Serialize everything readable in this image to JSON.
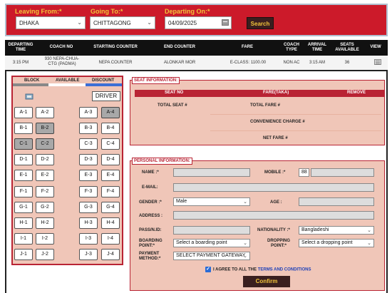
{
  "search": {
    "leaving_label": "Leaving From:*",
    "going_label": "Going To:*",
    "departing_label": "Departing On:*",
    "leaving_value": "DHAKA",
    "going_value": "CHITTAGONG",
    "date_value": "04/09/2025",
    "button": "Search"
  },
  "results": {
    "headers": [
      "DEPARTING TIME",
      "COACH NO",
      "STARTING COUNTER",
      "END COUNTER",
      "FARE",
      "COACH TYPE",
      "ARRIVAL TIME",
      "SEATS AVAILABLE",
      "VIEW"
    ],
    "rows": [
      {
        "departing": "3:15 PM",
        "coach_no": "930 NEPA-CHUA-CTG (PADMA)",
        "start": "NEPA COUNTER",
        "end": "ALONKAR MOR",
        "fare": "E-CLASS: 1100.00",
        "type": "NON AC",
        "arrival": "3:15 AM",
        "seats": "36"
      }
    ]
  },
  "seatmap": {
    "legend": {
      "block": "BLOCK",
      "available": "AVAILABLE",
      "discount": "DISCOUNT"
    },
    "legend_colors": {
      "block": "#888888",
      "available": "#ffffff",
      "discount": "#3c6fd6"
    },
    "driver": "DRIVER",
    "seats": [
      {
        "label": "A-1",
        "booked": false
      },
      {
        "label": "A-2",
        "booked": false
      },
      {
        "label": "A-3",
        "booked": false
      },
      {
        "label": "A-4",
        "booked": true
      },
      {
        "label": "B-1",
        "booked": false
      },
      {
        "label": "B-2",
        "booked": true
      },
      {
        "label": "B-3",
        "booked": false
      },
      {
        "label": "B-4",
        "booked": false
      },
      {
        "label": "C-1",
        "booked": true
      },
      {
        "label": "C-2",
        "booked": true
      },
      {
        "label": "C-3",
        "booked": false
      },
      {
        "label": "C-4",
        "booked": false
      },
      {
        "label": "D-1",
        "booked": false
      },
      {
        "label": "D-2",
        "booked": false
      },
      {
        "label": "D-3",
        "booked": false
      },
      {
        "label": "D-4",
        "booked": false
      },
      {
        "label": "E-1",
        "booked": false
      },
      {
        "label": "E-2",
        "booked": false
      },
      {
        "label": "E-3",
        "booked": false
      },
      {
        "label": "E-4",
        "booked": false
      },
      {
        "label": "F-1",
        "booked": false
      },
      {
        "label": "F-2",
        "booked": false
      },
      {
        "label": "F-3",
        "booked": false
      },
      {
        "label": "F-4",
        "booked": false
      },
      {
        "label": "G-1",
        "booked": false
      },
      {
        "label": "G-2",
        "booked": false
      },
      {
        "label": "G-3",
        "booked": false
      },
      {
        "label": "G-4",
        "booked": false
      },
      {
        "label": "H-1",
        "booked": false
      },
      {
        "label": "H-2",
        "booked": false
      },
      {
        "label": "H-3",
        "booked": false
      },
      {
        "label": "H-4",
        "booked": false
      },
      {
        "label": "I-1",
        "booked": false
      },
      {
        "label": "I-2",
        "booked": false
      },
      {
        "label": "I-3",
        "booked": false
      },
      {
        "label": "I-4",
        "booked": false
      },
      {
        "label": "J-1",
        "booked": false
      },
      {
        "label": "J-2",
        "booked": false
      },
      {
        "label": "J-3",
        "booked": false
      },
      {
        "label": "J-4",
        "booked": false
      }
    ]
  },
  "seat_info": {
    "title": "SEAT INFORMATION:",
    "col_seat": "SEAT NO",
    "col_fare": "FARE(TAKA)",
    "col_remove": "REMOVE",
    "total_seat": "TOTAL SEAT #",
    "total_fare": "TOTAL FARE #",
    "convenience": "CONVENIENCE CHARGE #",
    "net_fare": "NET FARE #"
  },
  "personal": {
    "title": "PERSONAL INFORMATION:",
    "name": "NAME :*",
    "mobile": "MOBILE :*",
    "mobile_code": "88",
    "email": "E-MAIL:",
    "gender": "GENDER :*",
    "gender_value": "Male",
    "age": "AGE :",
    "address": "ADDRESS :",
    "passport": "PASS/N.ID:",
    "nationality": "NATIONALITY :*",
    "nationality_value": "Bangladeshi",
    "boarding": "BOARDING POINT:*",
    "boarding_value": "Select a boarding point",
    "dropping": "DROPPING POINT:*",
    "dropping_value": "Select a dropping point",
    "payment": "PAYMENT METHOD:*",
    "payment_value": "SELECT PAYMENT GATEWAY",
    "agree_text": "I AGREE TO ALL THE",
    "terms": "TERMS AND CONDITIONS",
    "confirm": "Confirm"
  },
  "colors": {
    "brand_red": "#cc1a2a",
    "accent_yellow": "#f2c43a",
    "panel_pink": "#f0c6b8",
    "dark_button": "#3a1f1f"
  }
}
